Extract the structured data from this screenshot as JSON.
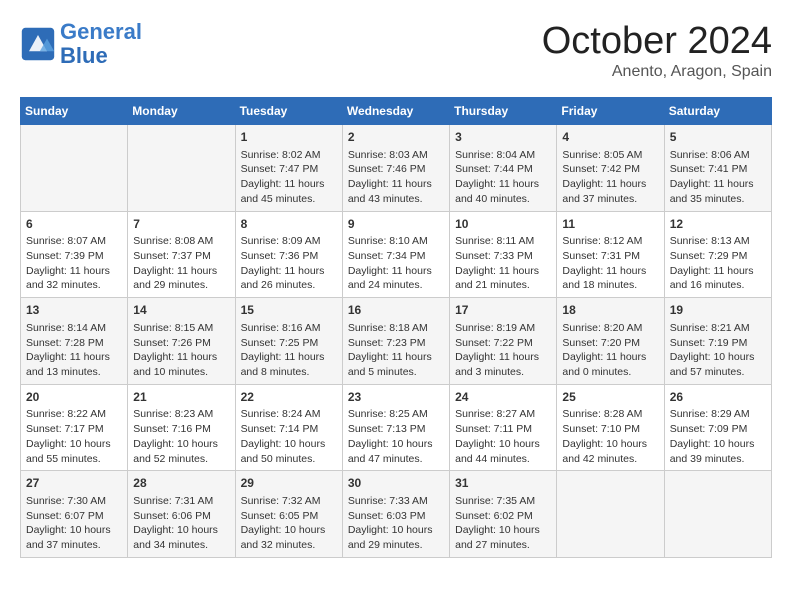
{
  "header": {
    "logo_line1": "General",
    "logo_line2": "Blue",
    "month_title": "October 2024",
    "location": "Anento, Aragon, Spain"
  },
  "calendar": {
    "days_of_week": [
      "Sunday",
      "Monday",
      "Tuesday",
      "Wednesday",
      "Thursday",
      "Friday",
      "Saturday"
    ],
    "weeks": [
      [
        {
          "day": "",
          "info": ""
        },
        {
          "day": "",
          "info": ""
        },
        {
          "day": "1",
          "info": "Sunrise: 8:02 AM\nSunset: 7:47 PM\nDaylight: 11 hours and 45 minutes."
        },
        {
          "day": "2",
          "info": "Sunrise: 8:03 AM\nSunset: 7:46 PM\nDaylight: 11 hours and 43 minutes."
        },
        {
          "day": "3",
          "info": "Sunrise: 8:04 AM\nSunset: 7:44 PM\nDaylight: 11 hours and 40 minutes."
        },
        {
          "day": "4",
          "info": "Sunrise: 8:05 AM\nSunset: 7:42 PM\nDaylight: 11 hours and 37 minutes."
        },
        {
          "day": "5",
          "info": "Sunrise: 8:06 AM\nSunset: 7:41 PM\nDaylight: 11 hours and 35 minutes."
        }
      ],
      [
        {
          "day": "6",
          "info": "Sunrise: 8:07 AM\nSunset: 7:39 PM\nDaylight: 11 hours and 32 minutes."
        },
        {
          "day": "7",
          "info": "Sunrise: 8:08 AM\nSunset: 7:37 PM\nDaylight: 11 hours and 29 minutes."
        },
        {
          "day": "8",
          "info": "Sunrise: 8:09 AM\nSunset: 7:36 PM\nDaylight: 11 hours and 26 minutes."
        },
        {
          "day": "9",
          "info": "Sunrise: 8:10 AM\nSunset: 7:34 PM\nDaylight: 11 hours and 24 minutes."
        },
        {
          "day": "10",
          "info": "Sunrise: 8:11 AM\nSunset: 7:33 PM\nDaylight: 11 hours and 21 minutes."
        },
        {
          "day": "11",
          "info": "Sunrise: 8:12 AM\nSunset: 7:31 PM\nDaylight: 11 hours and 18 minutes."
        },
        {
          "day": "12",
          "info": "Sunrise: 8:13 AM\nSunset: 7:29 PM\nDaylight: 11 hours and 16 minutes."
        }
      ],
      [
        {
          "day": "13",
          "info": "Sunrise: 8:14 AM\nSunset: 7:28 PM\nDaylight: 11 hours and 13 minutes."
        },
        {
          "day": "14",
          "info": "Sunrise: 8:15 AM\nSunset: 7:26 PM\nDaylight: 11 hours and 10 minutes."
        },
        {
          "day": "15",
          "info": "Sunrise: 8:16 AM\nSunset: 7:25 PM\nDaylight: 11 hours and 8 minutes."
        },
        {
          "day": "16",
          "info": "Sunrise: 8:18 AM\nSunset: 7:23 PM\nDaylight: 11 hours and 5 minutes."
        },
        {
          "day": "17",
          "info": "Sunrise: 8:19 AM\nSunset: 7:22 PM\nDaylight: 11 hours and 3 minutes."
        },
        {
          "day": "18",
          "info": "Sunrise: 8:20 AM\nSunset: 7:20 PM\nDaylight: 11 hours and 0 minutes."
        },
        {
          "day": "19",
          "info": "Sunrise: 8:21 AM\nSunset: 7:19 PM\nDaylight: 10 hours and 57 minutes."
        }
      ],
      [
        {
          "day": "20",
          "info": "Sunrise: 8:22 AM\nSunset: 7:17 PM\nDaylight: 10 hours and 55 minutes."
        },
        {
          "day": "21",
          "info": "Sunrise: 8:23 AM\nSunset: 7:16 PM\nDaylight: 10 hours and 52 minutes."
        },
        {
          "day": "22",
          "info": "Sunrise: 8:24 AM\nSunset: 7:14 PM\nDaylight: 10 hours and 50 minutes."
        },
        {
          "day": "23",
          "info": "Sunrise: 8:25 AM\nSunset: 7:13 PM\nDaylight: 10 hours and 47 minutes."
        },
        {
          "day": "24",
          "info": "Sunrise: 8:27 AM\nSunset: 7:11 PM\nDaylight: 10 hours and 44 minutes."
        },
        {
          "day": "25",
          "info": "Sunrise: 8:28 AM\nSunset: 7:10 PM\nDaylight: 10 hours and 42 minutes."
        },
        {
          "day": "26",
          "info": "Sunrise: 8:29 AM\nSunset: 7:09 PM\nDaylight: 10 hours and 39 minutes."
        }
      ],
      [
        {
          "day": "27",
          "info": "Sunrise: 7:30 AM\nSunset: 6:07 PM\nDaylight: 10 hours and 37 minutes."
        },
        {
          "day": "28",
          "info": "Sunrise: 7:31 AM\nSunset: 6:06 PM\nDaylight: 10 hours and 34 minutes."
        },
        {
          "day": "29",
          "info": "Sunrise: 7:32 AM\nSunset: 6:05 PM\nDaylight: 10 hours and 32 minutes."
        },
        {
          "day": "30",
          "info": "Sunrise: 7:33 AM\nSunset: 6:03 PM\nDaylight: 10 hours and 29 minutes."
        },
        {
          "day": "31",
          "info": "Sunrise: 7:35 AM\nSunset: 6:02 PM\nDaylight: 10 hours and 27 minutes."
        },
        {
          "day": "",
          "info": ""
        },
        {
          "day": "",
          "info": ""
        }
      ]
    ]
  }
}
